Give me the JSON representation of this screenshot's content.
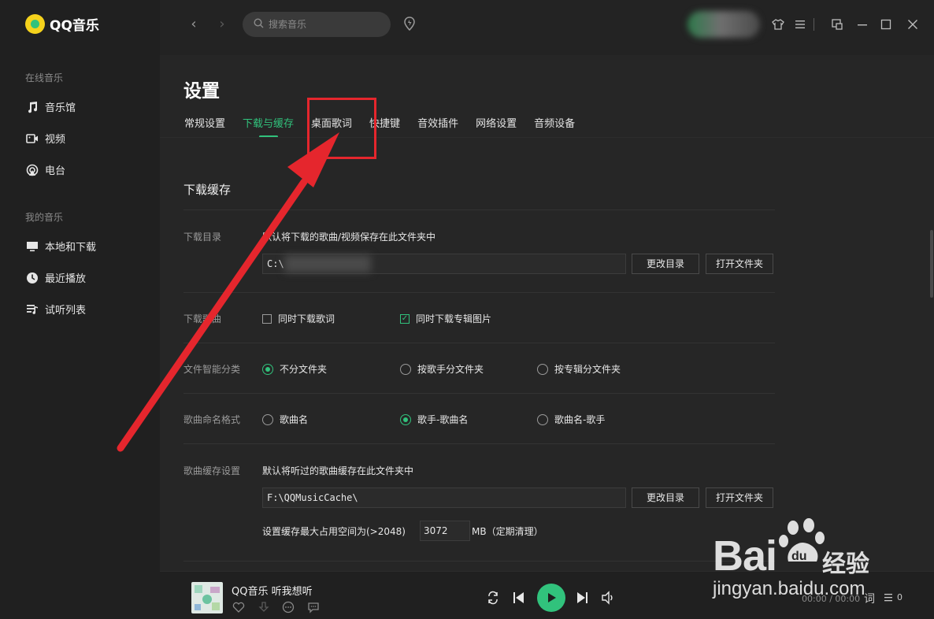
{
  "app": {
    "name": "QQ音乐",
    "accent": "#31c27c"
  },
  "sidebar": {
    "online_group": "在线音乐",
    "online_items": [
      {
        "label": "音乐馆",
        "icon": "music-note-icon"
      },
      {
        "label": "视频",
        "icon": "video-icon"
      },
      {
        "label": "电台",
        "icon": "radio-icon"
      }
    ],
    "my_group": "我的音乐",
    "my_items": [
      {
        "label": "本地和下载",
        "icon": "monitor-icon"
      },
      {
        "label": "最近播放",
        "icon": "clock-icon"
      },
      {
        "label": "试听列表",
        "icon": "playlist-icon"
      }
    ]
  },
  "topbar": {
    "search_placeholder": "搜索音乐"
  },
  "settings": {
    "title": "设置",
    "tabs": [
      "常规设置",
      "下载与缓存",
      "桌面歌词",
      "快捷键",
      "音效插件",
      "网络设置",
      "音频设备"
    ],
    "active_tab": "下载与缓存",
    "section_title": "下载缓存",
    "download_dir": {
      "label": "下载目录",
      "description": "默认将下载的歌曲/视频保存在此文件夹中",
      "path": "C:\\",
      "change_button": "更改目录",
      "open_button": "打开文件夹"
    },
    "download_song": {
      "label": "下载歌曲",
      "options": [
        {
          "label": "同时下载歌词",
          "checked": false
        },
        {
          "label": "同时下载专辑图片",
          "checked": true
        }
      ]
    },
    "file_sort": {
      "label": "文件智能分类",
      "options": [
        "不分文件夹",
        "按歌手分文件夹",
        "按专辑分文件夹"
      ],
      "selected": "不分文件夹"
    },
    "naming": {
      "label": "歌曲命名格式",
      "options": [
        "歌曲名",
        "歌手-歌曲名",
        "歌曲名-歌手"
      ],
      "selected": "歌手-歌曲名"
    },
    "cache": {
      "label": "歌曲缓存设置",
      "description": "默认将听过的歌曲缓存在此文件夹中",
      "path": "F:\\QQMusicCache\\",
      "change_button": "更改目录",
      "open_button": "打开文件夹",
      "size_label": "设置缓存最大占用空间为(>2048)",
      "size_value": "3072",
      "size_unit": "MB（定期清理）"
    }
  },
  "player": {
    "title": "QQ音乐 听我想听",
    "time": "00:00 / 00:00",
    "lyrics_label": "词",
    "playlist_count": "0"
  },
  "watermark": {
    "logo": "Bai",
    "logo2": "du",
    "text": "经验",
    "url": "jingyan.baidu.com"
  },
  "annotation_color": "#e5262d"
}
